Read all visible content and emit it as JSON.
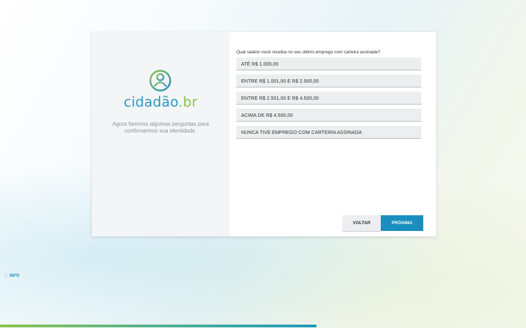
{
  "logo": {
    "text_part1": "cidadão",
    "text_part2": ".br",
    "icon": "user-circle-icon"
  },
  "left": {
    "message": "Agora faremos algumas perguntas para confirmarmos sua identidade."
  },
  "question": {
    "text": "Qual salário você recebia no seu último emprego com carteira assinada?",
    "options": [
      "ATÉ R$ 1.000,00",
      "ENTRE R$ 1.001,00 E R$ 2.500,00",
      "ENTRE R$ 2.501,00 E R$ 4.500,00",
      "ACIMA DE R$ 4.500,00",
      "NUNCA TIVE EMPREGO COM CARTEIRA ASSINADA"
    ]
  },
  "buttons": {
    "back": "VOLTAR",
    "next": "PRÓXIMA"
  },
  "info": {
    "icon": "info-icon",
    "label": "INFO"
  },
  "colors": {
    "accent": "#1a8fbf",
    "brand_green": "#8bc34a",
    "brand_blue": "#2a9bbf"
  }
}
